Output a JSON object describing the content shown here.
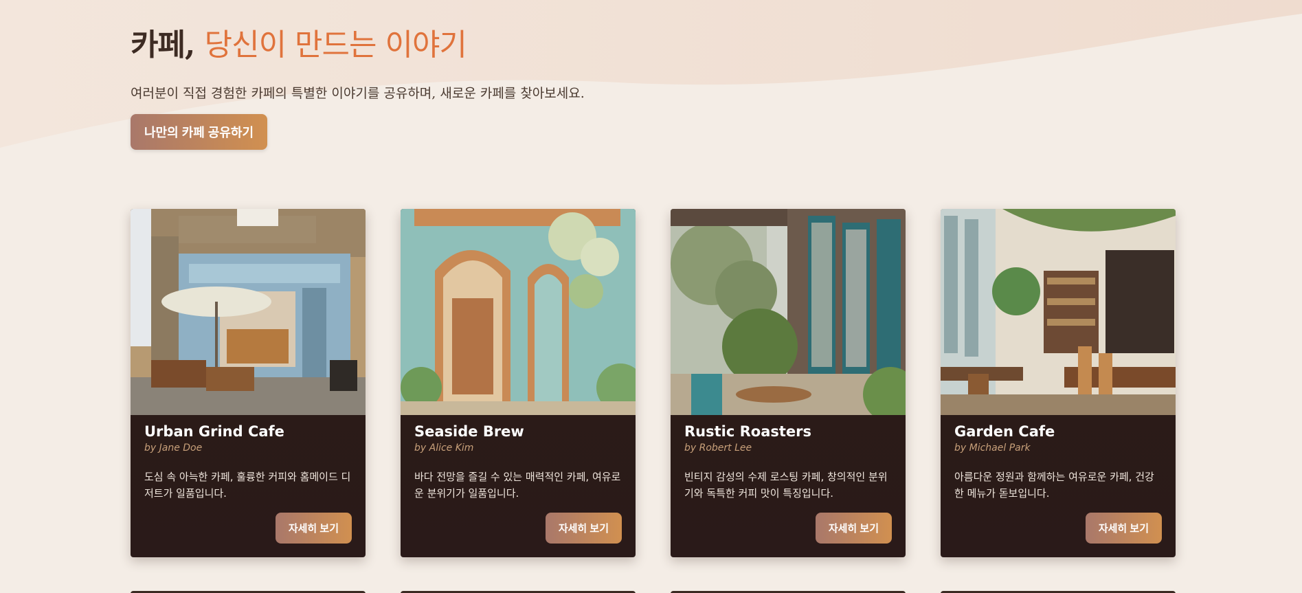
{
  "hero": {
    "title_main": "카페,",
    "title_accent": "당신이 만드는 이야기",
    "subtitle": "여러분이 직접 경험한 카페의 특별한 이야기를 공유하며, 새로운 카페를 찾아보세요.",
    "cta_label": "나만의 카페 공유하기"
  },
  "cards": [
    {
      "title": "Urban Grind Cafe",
      "author": "by Jane Doe",
      "description": "도심 속 아늑한 카페, 훌륭한 커피와 홈메이드 디저트가 일품입니다.",
      "button_label": "자세히 보기",
      "image": "bakery-storefront-photo"
    },
    {
      "title": "Seaside Brew",
      "author": "by Alice Kim",
      "description": "바다 전망을 즐길 수 있는 매력적인 카페, 여유로운 분위기가 일품입니다.",
      "button_label": "자세히 보기",
      "image": "teal-cafe-storefront-photo"
    },
    {
      "title": "Rustic Roasters",
      "author": "by Robert Lee",
      "description": "빈티지 감성의 수제 로스팅 카페, 창의적인 분위기와 독특한 커피 맛이 특징입니다.",
      "button_label": "자세히 보기",
      "image": "patio-cafe-photo"
    },
    {
      "title": "Garden Cafe",
      "author": "by Michael Park",
      "description": "아름다운 정원과 함께하는 여유로운 카페, 건강한 메뉴가 돋보입니다.",
      "button_label": "자세히 보기",
      "image": "interior-cafe-photo"
    }
  ],
  "colors": {
    "accent": "#e0733c",
    "button_gradient_start": "#a9786a",
    "button_gradient_end": "#d19050",
    "card_bg": "#2c1d16",
    "author_color": "#c8a07a"
  }
}
